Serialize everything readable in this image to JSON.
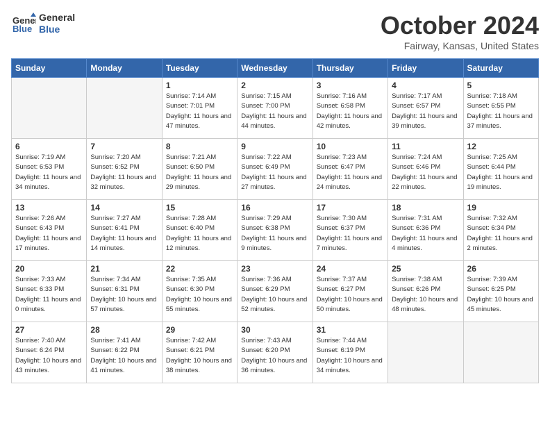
{
  "header": {
    "logo_line1": "General",
    "logo_line2": "Blue",
    "month": "October 2024",
    "location": "Fairway, Kansas, United States"
  },
  "weekdays": [
    "Sunday",
    "Monday",
    "Tuesday",
    "Wednesday",
    "Thursday",
    "Friday",
    "Saturday"
  ],
  "weeks": [
    [
      {
        "day": "",
        "info": ""
      },
      {
        "day": "",
        "info": ""
      },
      {
        "day": "1",
        "info": "Sunrise: 7:14 AM\nSunset: 7:01 PM\nDaylight: 11 hours and 47 minutes."
      },
      {
        "day": "2",
        "info": "Sunrise: 7:15 AM\nSunset: 7:00 PM\nDaylight: 11 hours and 44 minutes."
      },
      {
        "day": "3",
        "info": "Sunrise: 7:16 AM\nSunset: 6:58 PM\nDaylight: 11 hours and 42 minutes."
      },
      {
        "day": "4",
        "info": "Sunrise: 7:17 AM\nSunset: 6:57 PM\nDaylight: 11 hours and 39 minutes."
      },
      {
        "day": "5",
        "info": "Sunrise: 7:18 AM\nSunset: 6:55 PM\nDaylight: 11 hours and 37 minutes."
      }
    ],
    [
      {
        "day": "6",
        "info": "Sunrise: 7:19 AM\nSunset: 6:53 PM\nDaylight: 11 hours and 34 minutes."
      },
      {
        "day": "7",
        "info": "Sunrise: 7:20 AM\nSunset: 6:52 PM\nDaylight: 11 hours and 32 minutes."
      },
      {
        "day": "8",
        "info": "Sunrise: 7:21 AM\nSunset: 6:50 PM\nDaylight: 11 hours and 29 minutes."
      },
      {
        "day": "9",
        "info": "Sunrise: 7:22 AM\nSunset: 6:49 PM\nDaylight: 11 hours and 27 minutes."
      },
      {
        "day": "10",
        "info": "Sunrise: 7:23 AM\nSunset: 6:47 PM\nDaylight: 11 hours and 24 minutes."
      },
      {
        "day": "11",
        "info": "Sunrise: 7:24 AM\nSunset: 6:46 PM\nDaylight: 11 hours and 22 minutes."
      },
      {
        "day": "12",
        "info": "Sunrise: 7:25 AM\nSunset: 6:44 PM\nDaylight: 11 hours and 19 minutes."
      }
    ],
    [
      {
        "day": "13",
        "info": "Sunrise: 7:26 AM\nSunset: 6:43 PM\nDaylight: 11 hours and 17 minutes."
      },
      {
        "day": "14",
        "info": "Sunrise: 7:27 AM\nSunset: 6:41 PM\nDaylight: 11 hours and 14 minutes."
      },
      {
        "day": "15",
        "info": "Sunrise: 7:28 AM\nSunset: 6:40 PM\nDaylight: 11 hours and 12 minutes."
      },
      {
        "day": "16",
        "info": "Sunrise: 7:29 AM\nSunset: 6:38 PM\nDaylight: 11 hours and 9 minutes."
      },
      {
        "day": "17",
        "info": "Sunrise: 7:30 AM\nSunset: 6:37 PM\nDaylight: 11 hours and 7 minutes."
      },
      {
        "day": "18",
        "info": "Sunrise: 7:31 AM\nSunset: 6:36 PM\nDaylight: 11 hours and 4 minutes."
      },
      {
        "day": "19",
        "info": "Sunrise: 7:32 AM\nSunset: 6:34 PM\nDaylight: 11 hours and 2 minutes."
      }
    ],
    [
      {
        "day": "20",
        "info": "Sunrise: 7:33 AM\nSunset: 6:33 PM\nDaylight: 11 hours and 0 minutes."
      },
      {
        "day": "21",
        "info": "Sunrise: 7:34 AM\nSunset: 6:31 PM\nDaylight: 10 hours and 57 minutes."
      },
      {
        "day": "22",
        "info": "Sunrise: 7:35 AM\nSunset: 6:30 PM\nDaylight: 10 hours and 55 minutes."
      },
      {
        "day": "23",
        "info": "Sunrise: 7:36 AM\nSunset: 6:29 PM\nDaylight: 10 hours and 52 minutes."
      },
      {
        "day": "24",
        "info": "Sunrise: 7:37 AM\nSunset: 6:27 PM\nDaylight: 10 hours and 50 minutes."
      },
      {
        "day": "25",
        "info": "Sunrise: 7:38 AM\nSunset: 6:26 PM\nDaylight: 10 hours and 48 minutes."
      },
      {
        "day": "26",
        "info": "Sunrise: 7:39 AM\nSunset: 6:25 PM\nDaylight: 10 hours and 45 minutes."
      }
    ],
    [
      {
        "day": "27",
        "info": "Sunrise: 7:40 AM\nSunset: 6:24 PM\nDaylight: 10 hours and 43 minutes."
      },
      {
        "day": "28",
        "info": "Sunrise: 7:41 AM\nSunset: 6:22 PM\nDaylight: 10 hours and 41 minutes."
      },
      {
        "day": "29",
        "info": "Sunrise: 7:42 AM\nSunset: 6:21 PM\nDaylight: 10 hours and 38 minutes."
      },
      {
        "day": "30",
        "info": "Sunrise: 7:43 AM\nSunset: 6:20 PM\nDaylight: 10 hours and 36 minutes."
      },
      {
        "day": "31",
        "info": "Sunrise: 7:44 AM\nSunset: 6:19 PM\nDaylight: 10 hours and 34 minutes."
      },
      {
        "day": "",
        "info": ""
      },
      {
        "day": "",
        "info": ""
      }
    ]
  ]
}
